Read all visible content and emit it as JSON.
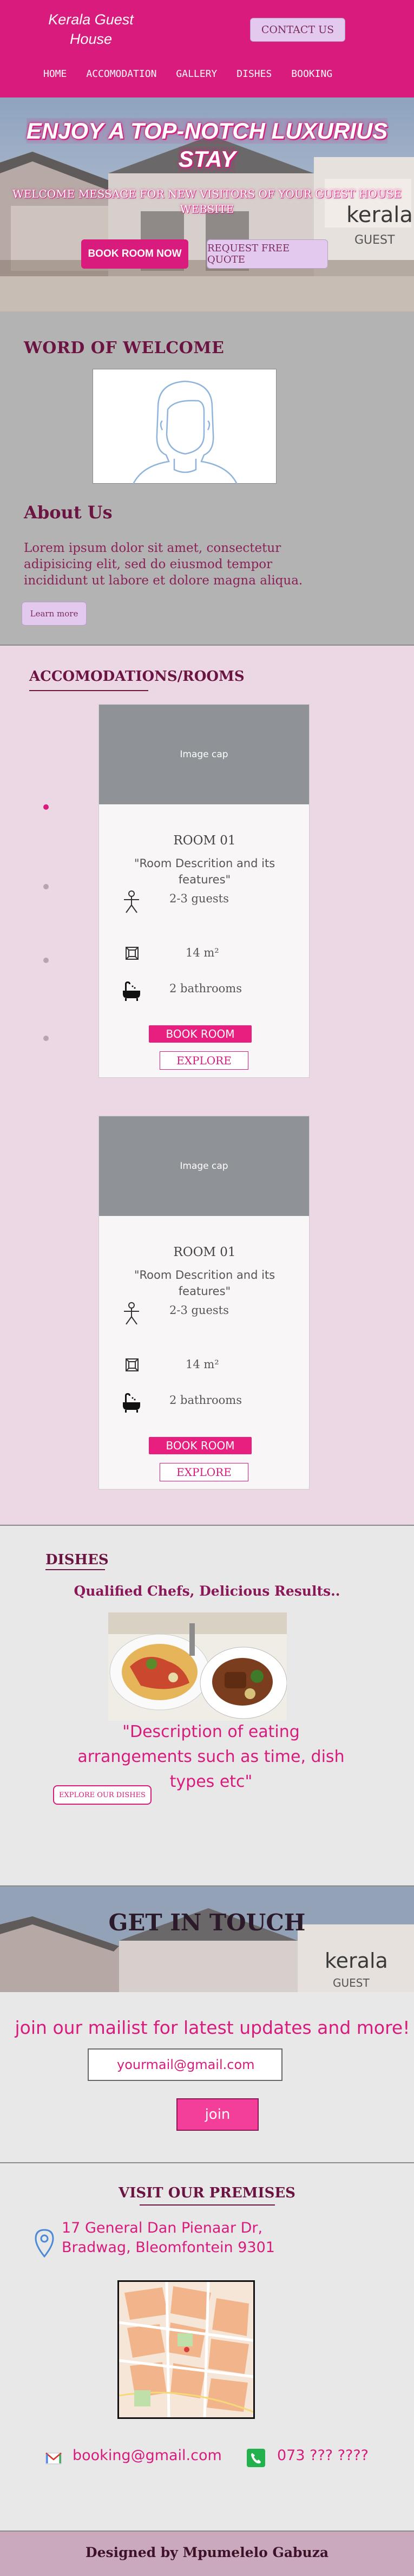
{
  "header": {
    "brand": "Kerala Guest House",
    "contact_button": "CONTACT US",
    "nav": [
      "HOME",
      "ACCOMODATION",
      "GALLERY",
      "DISHES",
      "BOOKING"
    ]
  },
  "hero": {
    "title": "ENJOY A TOP-NOTCH LUXURIUS STAY",
    "subtitle": "WELCOME MESSAGE FOR NEW VISITORS OF YOUR GUEST HOUSE WEBSITE",
    "book_now": "BOOK ROOM NOW",
    "free_quote": "REQUEST FREE QUOTE"
  },
  "welcome": {
    "title": "WORD OF WELCOME"
  },
  "about": {
    "title": "About Us",
    "text": "Lorem ipsum dolor sit amet, consectetur adipisicing elit, sed do eiusmod tempor incididunt ut labore et dolore magna aliqua.",
    "learn_more": "Learn more"
  },
  "accommodations": {
    "title": "ACCOMODATIONS/ROOMS",
    "carousel_active_index": 0,
    "carousel_dot_count": 4,
    "rooms": [
      {
        "image_cap": "Image cap",
        "name": "ROOM 01",
        "description": "\"Room Descrition and its features\"",
        "guests": "2-3 guests",
        "size": "14 m²",
        "bathrooms": "2 bathrooms",
        "book_label": "BOOK ROOM",
        "explore_label": "EXPLORE"
      },
      {
        "image_cap": "Image cap",
        "name": "ROOM 01",
        "description": "\"Room Descrition and its features\"",
        "guests": "2-3 guests",
        "size": "14 m²",
        "bathrooms": "2 bathrooms",
        "book_label": "BOOK ROOM",
        "explore_label": "EXPLORE"
      }
    ]
  },
  "dishes": {
    "title": "DISHES",
    "tagline": "Qualified Chefs, Delicious Results..",
    "description": "\"Description of eating arrangements such as time, dish types etc\"",
    "explore_button": "EXPLORE OUR DISHES"
  },
  "touch": {
    "title": "GET IN TOUCH"
  },
  "mailing": {
    "title": "join our mailist for latest updates and more!",
    "input_value": "yourmail@gmail.com",
    "join_button": "join"
  },
  "premises": {
    "title": "VISIT OUR PREMISES",
    "address": "17 General Dan Pienaar Dr, Bradwag, Bleomfontein 9301",
    "email": "booking@gmail.com",
    "phone": "073 ??? ????"
  },
  "footer": {
    "credit": "Designed by Mpumelelo Gabuza"
  },
  "colors": {
    "primary": "#d81b7c",
    "dark_accent": "#6b1442",
    "light_button": "#e3c9ee",
    "section_gray": "#b3b3b3",
    "section_pink": "#ecd8e4"
  }
}
